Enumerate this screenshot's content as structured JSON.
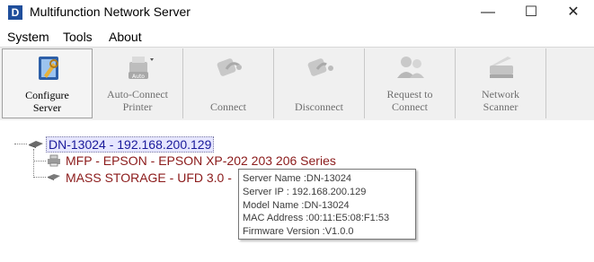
{
  "window": {
    "title": "Multifunction Network Server",
    "icon_letter": "D",
    "controls": {
      "minimize": "—",
      "maximize": "☐",
      "close": "✕"
    }
  },
  "menu": {
    "items": [
      "System",
      "Tools",
      "About"
    ]
  },
  "toolbar": {
    "buttons": [
      {
        "label": "Configure\nServer",
        "icon": "configure-server-icon",
        "enabled": true
      },
      {
        "label": "Auto-Connect\nPrinter",
        "icon": "auto-connect-printer-icon",
        "enabled": false
      },
      {
        "label": "Connect",
        "icon": "connect-icon",
        "enabled": false
      },
      {
        "label": "Disconnect",
        "icon": "disconnect-icon",
        "enabled": false
      },
      {
        "label": "Request to\nConnect",
        "icon": "request-connect-icon",
        "enabled": false
      },
      {
        "label": "Network\nScanner",
        "icon": "network-scanner-icon",
        "enabled": false
      }
    ]
  },
  "tree": {
    "root": "DN-13024 - 192.168.200.129",
    "children": [
      "MFP - EPSON - EPSON XP-202 203 206 Series",
      "MASS STORAGE - UFD 3.0 -"
    ]
  },
  "tooltip": {
    "lines": [
      "Server Name :DN-13024",
      "Server IP : 192.168.200.129",
      "Model Name :DN-13024",
      "MAC Address :00:11:E5:08:F1:53",
      "Firmware Version :V1.0.0"
    ]
  },
  "colors": {
    "root_text": "#1a1a9a",
    "child_text": "#8b1a1a",
    "app_icon": "#1f4e9b"
  }
}
